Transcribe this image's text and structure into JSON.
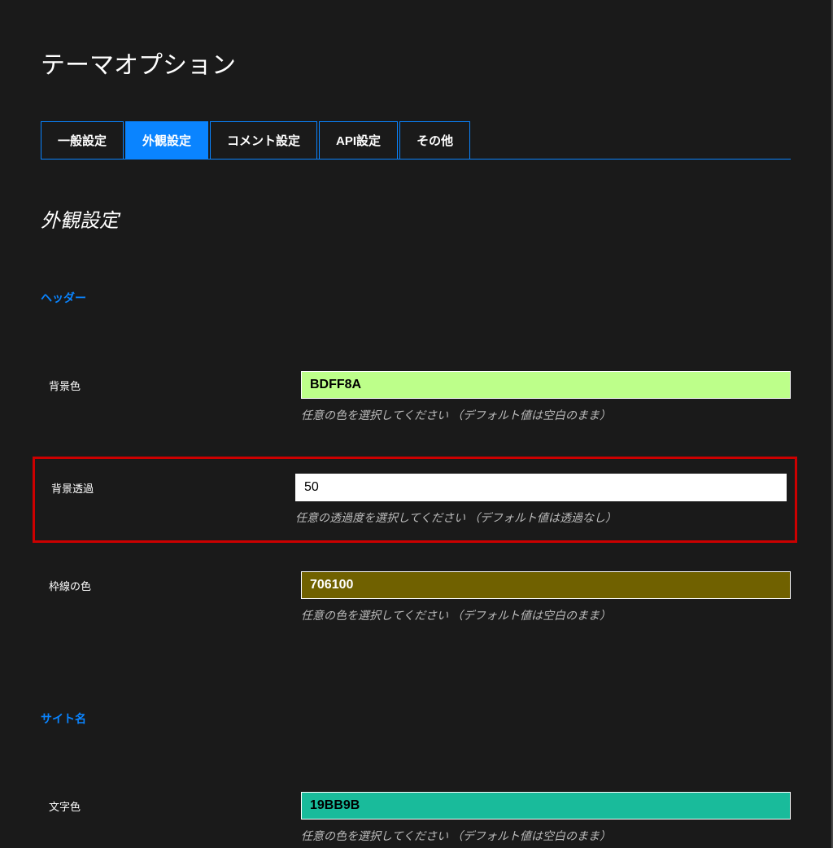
{
  "pageTitle": "テーマオプション",
  "tabs": [
    {
      "label": "一般設定",
      "active": false
    },
    {
      "label": "外観設定",
      "active": true
    },
    {
      "label": "コメント設定",
      "active": false
    },
    {
      "label": "API設定",
      "active": false
    },
    {
      "label": "その他",
      "active": false
    }
  ],
  "sectionTitle": "外観設定",
  "header": {
    "subsectionTitle": "ヘッダー",
    "bgColor": {
      "label": "背景色",
      "value": "BDFF8A",
      "hint": "任意の色を選択してください （デフォルト値は空白のまま）",
      "bgHex": "#BDFF8A"
    },
    "bgOpacity": {
      "label": "背景透過",
      "value": "50",
      "hint": "任意の透過度を選択してください （デフォルト値は透過なし）"
    },
    "borderColor": {
      "label": "枠線の色",
      "value": "706100",
      "hint": "任意の色を選択してください （デフォルト値は空白のまま）",
      "bgHex": "#706100"
    }
  },
  "siteName": {
    "subsectionTitle": "サイト名",
    "textColor": {
      "label": "文字色",
      "value": "19BB9B",
      "hint": "任意の色を選択してください （デフォルト値は空白のまま）",
      "bgHex": "#19BB9B"
    }
  }
}
